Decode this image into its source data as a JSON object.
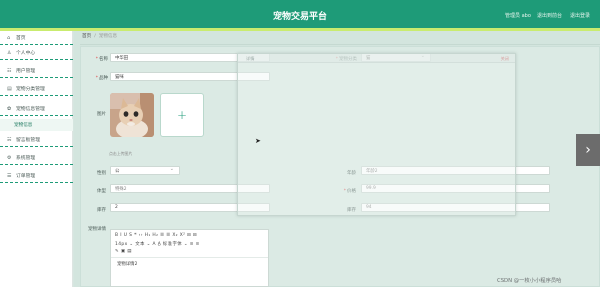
{
  "header": {
    "title": "宠物交易平台",
    "links": [
      "管理员 abo",
      "退出到前台",
      "退出登录"
    ]
  },
  "sidebar": {
    "items": [
      {
        "icon": "home-icon",
        "glyph": "⌂",
        "label": "首页"
      },
      {
        "icon": "user-icon",
        "glyph": "♙",
        "label": "个人中心"
      },
      {
        "icon": "users-icon",
        "glyph": "☷",
        "label": "用户管理"
      },
      {
        "icon": "category-icon",
        "glyph": "▤",
        "label": "宠物分类管理"
      },
      {
        "icon": "pet-icon",
        "glyph": "✿",
        "label": "宠物信息管理"
      },
      {
        "icon": "forum-icon",
        "glyph": "☵",
        "label": "留言板管理"
      },
      {
        "icon": "settings-icon",
        "glyph": "⚙",
        "label": "系统管理"
      },
      {
        "icon": "order-icon",
        "glyph": "☰",
        "label": "订单管理"
      }
    ],
    "sub_item": "宠物信息"
  },
  "breadcrumb": {
    "home": "首页",
    "current": "宠物信息"
  },
  "form": {
    "name_label": "名称",
    "name_value": "中华田",
    "category_label": "宠物分类",
    "category_value": "猫",
    "breed_label": "品种",
    "breed_value": "猫咪",
    "image_label": "图片",
    "upload_glyph": "+",
    "upload_hint": "点击上传图片",
    "gender_label": "性别",
    "gender_value": "公",
    "age_label": "年龄",
    "age_value": "年龄2",
    "body_label": "体型",
    "body_value": "特殊2",
    "price_label": "价格",
    "price_value": "99.9",
    "stock_label": "库存",
    "stock_value": "2",
    "sales_label": "库存",
    "sales_value": "94",
    "detail_label": "宠物详情",
    "editor_toolbar_1": "B  I  U  S  ❝  ‹›  H₁  H₂  ☰  ☰  X₂  X²  ⊟  ⊟",
    "editor_toolbar_2": "14px  ⌄  文本  ⌄  A  A̲  标准字体  ⌄  ≡  ≡",
    "editor_toolbar_3": "✎  ▣  ▤",
    "editor_text": "宠物详情2"
  },
  "overlay": {
    "title": "详情",
    "close": "关闭"
  },
  "next_glyph": "›",
  "watermark": "CSDN @一枚小小程序员哈"
}
